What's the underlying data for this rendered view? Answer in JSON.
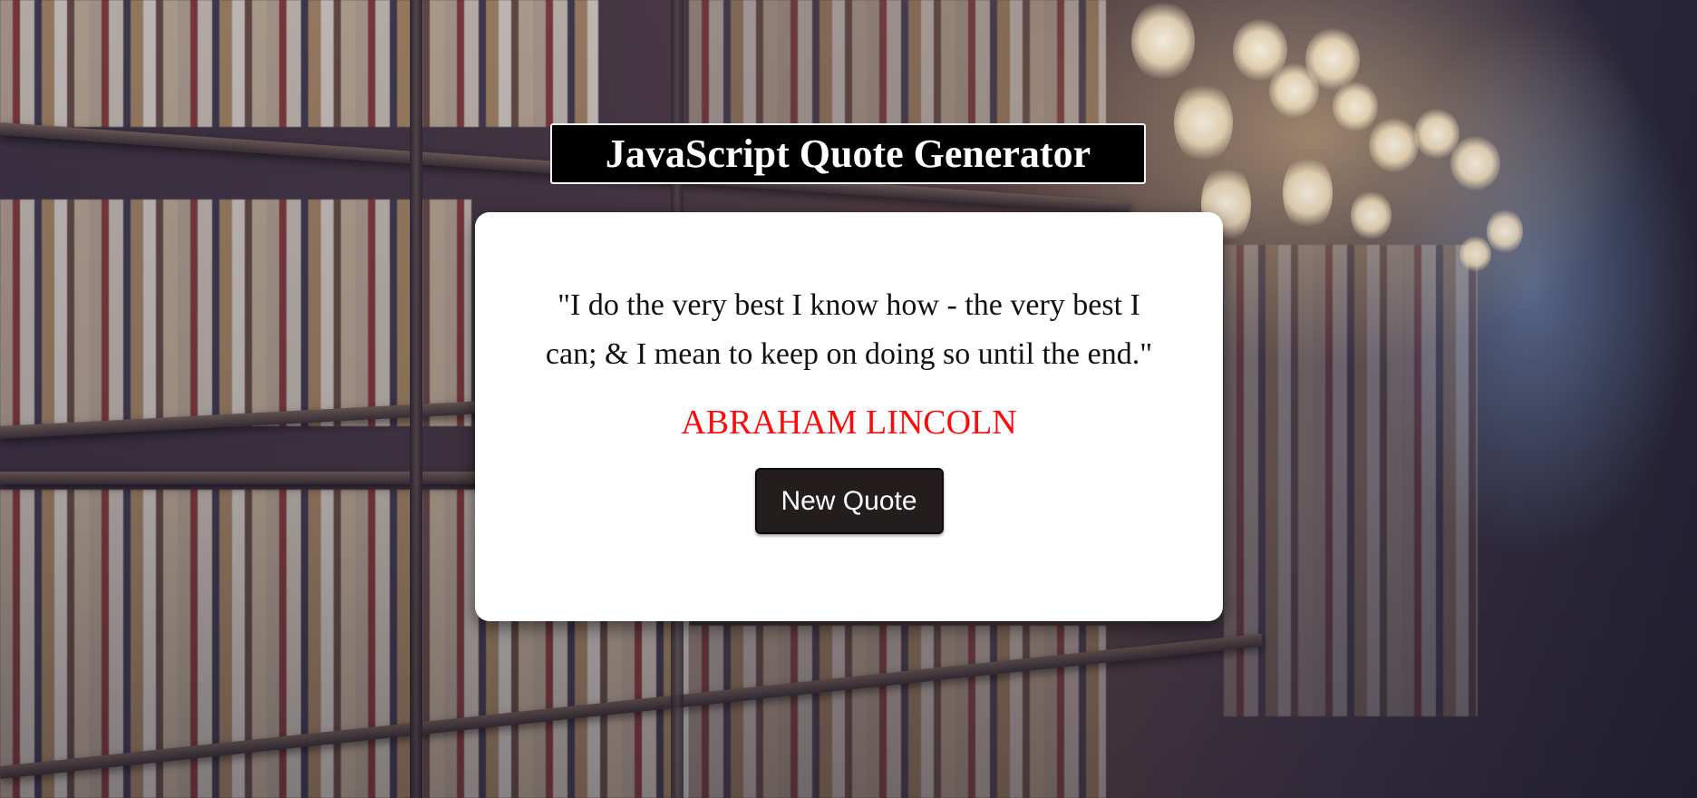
{
  "header": {
    "title": "JavaScript Quote Generator"
  },
  "quote_card": {
    "quote_text": "\"I do the very best I know how - the very best I can; & I mean to keep on doing so until the end.\"",
    "author": "ABRAHAM LINCOLN",
    "new_quote_label": "New Quote"
  },
  "colors": {
    "author_text": "#ff0a0a",
    "button_bg": "#231d1d",
    "title_bg": "#000000",
    "card_bg": "#ffffff"
  },
  "background": {
    "description_icon": "library-bookshelf-background"
  }
}
